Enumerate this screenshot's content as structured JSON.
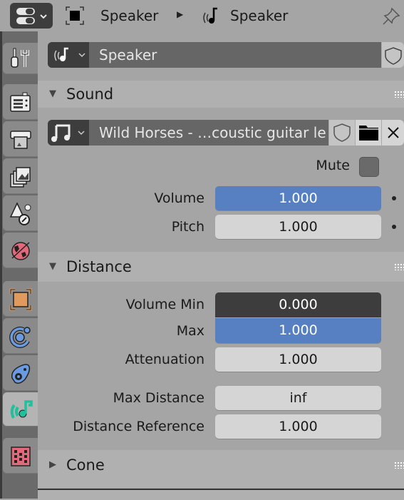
{
  "header": {
    "editor_type_icon": "properties-editor-icon",
    "breadcrumb": [
      {
        "icon": "object-icon",
        "label": "Speaker"
      },
      {
        "icon": "speaker-data-icon",
        "label": "Speaker"
      }
    ],
    "pin_icon": "pin-icon"
  },
  "sidebar": {
    "tabs": [
      {
        "name": "tool",
        "icon": "tool-icon"
      },
      {
        "name": "render",
        "icon": "render-icon"
      },
      {
        "name": "output",
        "icon": "output-icon"
      },
      {
        "name": "view-layer",
        "icon": "view-layer-icon"
      },
      {
        "name": "scene",
        "icon": "scene-icon"
      },
      {
        "name": "world",
        "icon": "world-icon"
      },
      {
        "name": "object",
        "icon": "object-icon"
      },
      {
        "name": "physics",
        "icon": "physics-icon"
      },
      {
        "name": "constraints",
        "icon": "object-constraints-icon"
      },
      {
        "name": "speaker-data",
        "icon": "speaker-data-icon",
        "active": true
      },
      {
        "name": "texture",
        "icon": "texture-icon"
      }
    ]
  },
  "datablock": {
    "name": "Speaker"
  },
  "sound_panel": {
    "title": "Sound",
    "sound_file": "Wild Horses - …coustic guitar le",
    "mute_label": "Mute",
    "mute_checked": false,
    "volume_label": "Volume",
    "volume_value": "1.000",
    "pitch_label": "Pitch",
    "pitch_value": "1.000"
  },
  "distance_panel": {
    "title": "Distance",
    "volume_min_label": "Volume Min",
    "volume_min_value": "0.000",
    "max_label": "Max",
    "max_value": "1.000",
    "attenuation_label": "Attenuation",
    "attenuation_value": "1.000",
    "max_distance_label": "Max Distance",
    "max_distance_value": "inf",
    "distance_reference_label": "Distance Reference",
    "distance_reference_value": "1.000"
  },
  "cone_panel": {
    "title": "Cone"
  },
  "colors": {
    "accent_blue": "#5680c2",
    "speaker_green": "#1fc09a",
    "object_orange": "#e09a5e",
    "world_red": "#e06a7a",
    "physics_blue": "#6a9ae0"
  }
}
